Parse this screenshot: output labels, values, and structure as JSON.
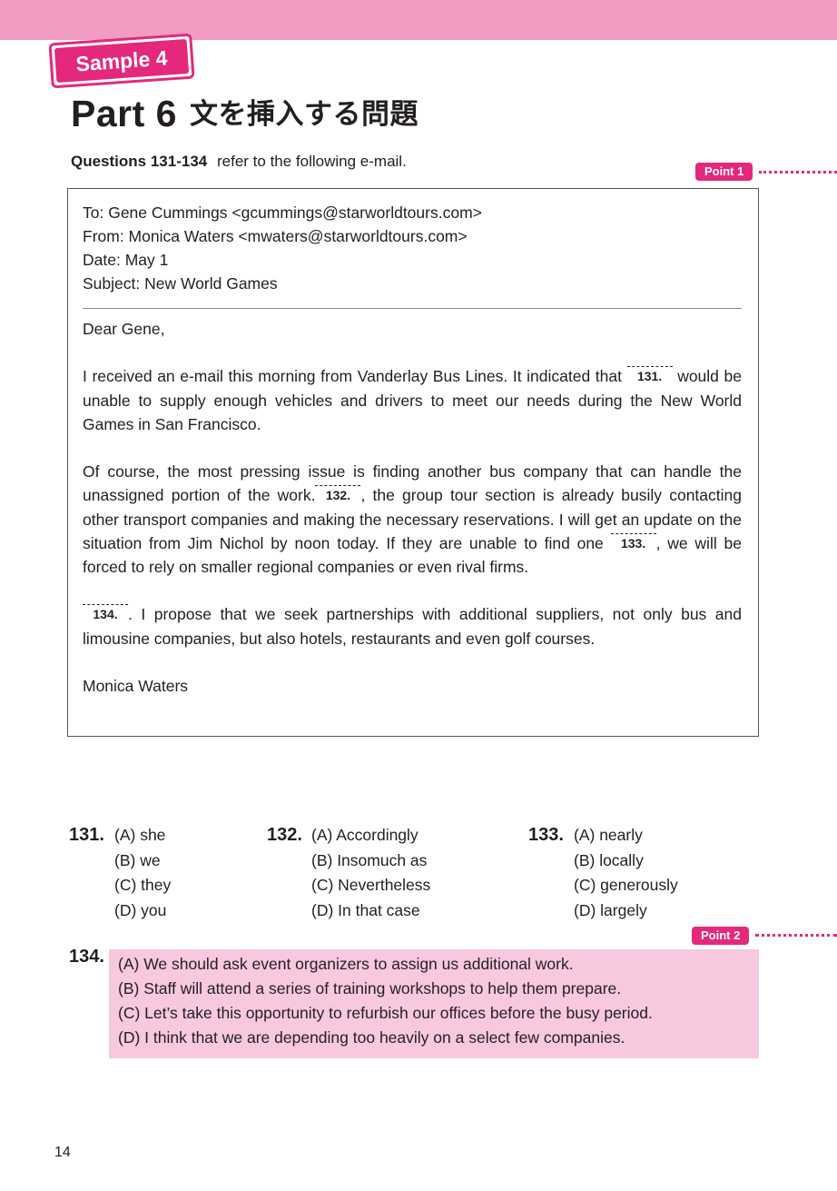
{
  "header": {
    "sample_label": "Sample 4",
    "title": "Part 6",
    "title_jp": "文を挿入する問題"
  },
  "intro": {
    "bold": "Questions 131-134",
    "text": "refer to the following e-mail."
  },
  "points": {
    "p1": "Point 1",
    "p2": "Point 2"
  },
  "email": {
    "to": "To: Gene Cummings <gcummings@starworldtours.com>",
    "from": "From: Monica Waters <mwaters@starworldtours.com>",
    "date": "Date: May 1",
    "subject": "Subject: New World Games",
    "greeting": "Dear Gene,",
    "p1a": "I received an e-mail this morning from Vanderlay Bus Lines. It indicated that",
    "p1b": "would be unable to supply enough vehicles and drivers to meet our needs during the New World Games in San Francisco.",
    "p2a": "Of course, the most pressing issue is finding another bus company that can handle the unassigned portion of the work.",
    "p2b": ", the group tour section is already busily contacting other transport companies and making the necessary reservations. I will get an update on the situation from Jim Nichol by noon today. If they are unable to find one",
    "p2c": ", we will be forced to rely on smaller regional companies or even rival firms.",
    "p3": ". I propose that we seek partnerships with additional suppliers, not only bus and limousine companies, but also hotels, restaurants and even golf courses.",
    "signature": "Monica Waters",
    "blanks": [
      "131.",
      "132.",
      "133.",
      "134."
    ]
  },
  "questions": {
    "q131": {
      "num": "131.",
      "options": [
        "(A) she",
        "(B) we",
        "(C) they",
        "(D) you"
      ]
    },
    "q132": {
      "num": "132.",
      "options": [
        "(A) Accordingly",
        "(B) Insomuch as",
        "(C) Nevertheless",
        "(D) In that case"
      ]
    },
    "q133": {
      "num": "133.",
      "options": [
        "(A) nearly",
        "(B) locally",
        "(C) generously",
        "(D) largely"
      ]
    },
    "q134": {
      "num": "134.",
      "options": [
        "(A) We should ask event organizers to assign us additional work.",
        "(B) Staff will attend a series of training workshops to help them prepare.",
        "(C) Let’s take this opportunity to refurbish our offices before the busy period.",
        "(D) I think that we are depending too heavily on a select few companies."
      ]
    }
  },
  "page_number": "14",
  "colors": {
    "accent": "#e4287c",
    "top_bar": "#f29cc3",
    "highlight": "#f7c8de"
  }
}
